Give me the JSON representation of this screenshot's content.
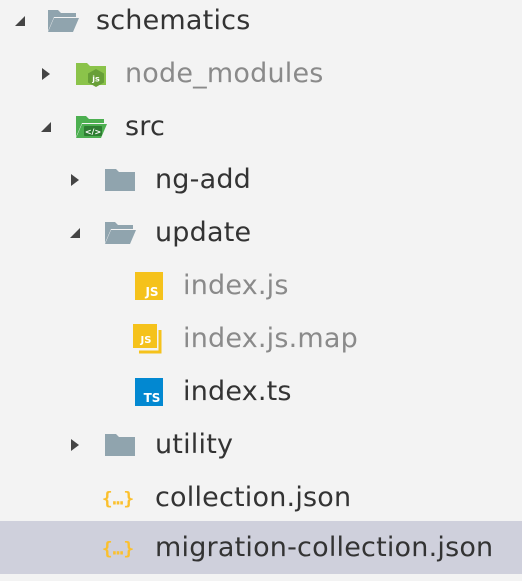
{
  "explorer": {
    "items": [
      {
        "label": "schematics"
      },
      {
        "label": "node_modules"
      },
      {
        "label": "src"
      },
      {
        "label": "ng-add"
      },
      {
        "label": "update"
      },
      {
        "label": "index.js"
      },
      {
        "label": "index.js.map"
      },
      {
        "label": "index.ts"
      },
      {
        "label": "utility"
      },
      {
        "label": "collection.json"
      },
      {
        "label": "migration-collection.json"
      }
    ],
    "icons": {
      "js_badge": "JS",
      "ts_badge": "TS",
      "json_glyph": "{...}",
      "node_badge": "JS",
      "src_badge": "</>"
    }
  },
  "colors": {
    "folder": "#90a4ae",
    "node_folder": "#8bc34a",
    "src_folder": "#4caf50",
    "js_icon": "#f5c21b",
    "ts_icon": "#0288d1",
    "json_icon": "#fbc02d",
    "selected_row": "#cfd0dc"
  }
}
